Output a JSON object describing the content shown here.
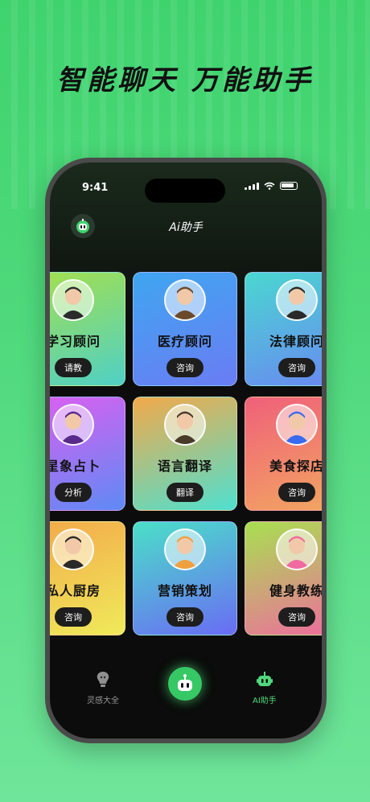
{
  "headline": "智能聊天  万能助手",
  "status": {
    "time": "9:41"
  },
  "app": {
    "title": "Ai助手"
  },
  "cards": [
    {
      "title": "学习顾问",
      "button": "请教",
      "gradient": [
        "#a6e04a",
        "#4fd0c6"
      ]
    },
    {
      "title": "医疗顾问",
      "button": "咨询",
      "gradient": [
        "#3fa6f0",
        "#6a7cf4"
      ]
    },
    {
      "title": "法律顾问",
      "button": "咨询",
      "gradient": [
        "#4ad7d1",
        "#6a86f2"
      ]
    },
    {
      "title": "星象占卜",
      "button": "分析",
      "gradient": [
        "#e05ef0",
        "#5e8af4"
      ]
    },
    {
      "title": "语言翻译",
      "button": "翻译",
      "gradient": [
        "#f2a94a",
        "#4fe0d0"
      ]
    },
    {
      "title": "美食探店",
      "button": "咨询",
      "gradient": [
        "#f0607a",
        "#f2a860"
      ]
    },
    {
      "title": "私人厨房",
      "button": "咨询",
      "gradient": [
        "#f2a84a",
        "#f0ea5a"
      ]
    },
    {
      "title": "营销策划",
      "button": "咨询",
      "gradient": [
        "#4ae0c8",
        "#6a6cf4"
      ]
    },
    {
      "title": "健身教练",
      "button": "咨询",
      "gradient": [
        "#a8e050",
        "#f06aa0"
      ]
    }
  ],
  "tabbar": {
    "left": {
      "label": "灵感大全",
      "icon": "lightbulb-icon"
    },
    "center": {
      "icon": "robot-icon"
    },
    "right": {
      "label": "AI助手",
      "icon": "robot-icon"
    }
  },
  "colors": {
    "accent": "#4fd97c",
    "background": "#3fd36e"
  }
}
